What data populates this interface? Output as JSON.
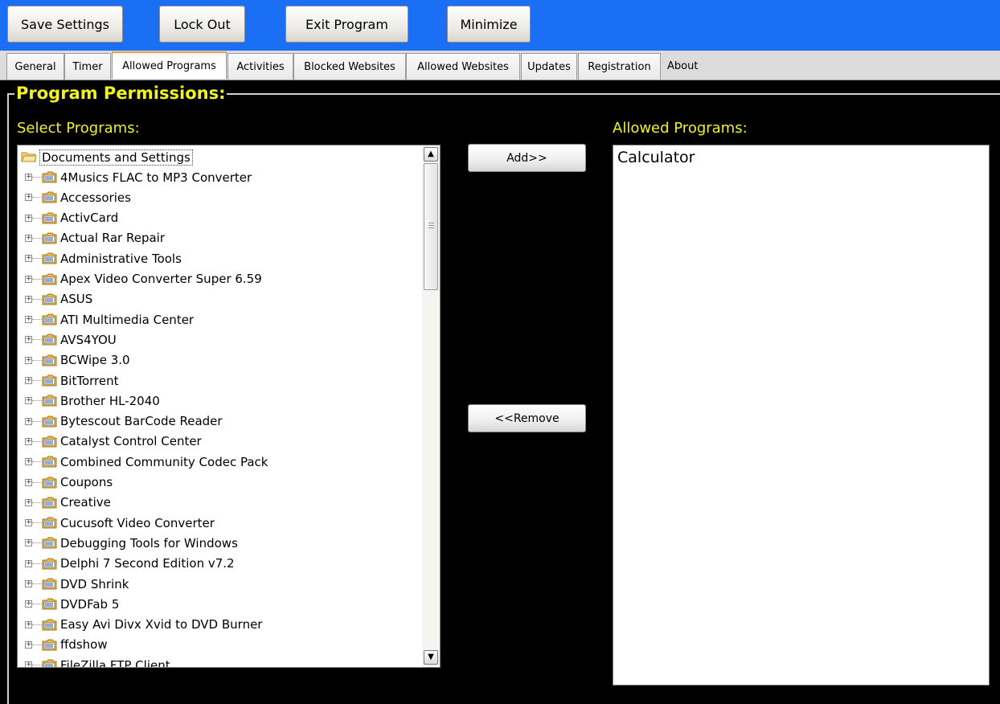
{
  "toolbar": {
    "save_settings": "Save Settings",
    "lock_out": "Lock Out",
    "exit_program": "Exit Program",
    "minimize": "Minimize"
  },
  "tabs": [
    "General",
    "Timer",
    "Allowed Programs",
    "Activities",
    "Blocked Websites",
    "Allowed Websites",
    "Updates",
    "Registration",
    "About"
  ],
  "active_tab": "Allowed Programs",
  "frame_title": "Program Permissions:",
  "select_label": "Select Programs:",
  "allowed_label": "Allowed Programs:",
  "tree": {
    "root": "Documents and Settings",
    "items": [
      "4Musics FLAC to MP3 Converter",
      "Accessories",
      "ActivCard",
      "Actual Rar Repair",
      "Administrative Tools",
      "Apex Video Converter Super 6.59",
      "ASUS",
      "ATI Multimedia Center",
      "AVS4YOU",
      "BCWipe 3.0",
      "BitTorrent",
      "Brother HL-2040",
      "Bytescout BarCode Reader",
      "Catalyst Control Center",
      "Combined Community Codec Pack",
      "Coupons",
      "Creative",
      "Cucusoft Video Converter",
      "Debugging Tools for Windows",
      "Delphi 7 Second Edition v7.2",
      "DVD Shrink",
      "DVDFab 5",
      "Easy Avi Divx Xvid to DVD Burner",
      "ffdshow",
      "FileZilla FTP Client"
    ]
  },
  "buttons": {
    "add": "Add>>",
    "remove": "<<Remove"
  },
  "allowed_programs": [
    "Calculator"
  ],
  "colors": {
    "toolbar_bg": "#1a6ff5",
    "label_yellow": "#f2f21e",
    "tab_accent": "#f0a030"
  },
  "icons": {
    "root": "open-folder-icon",
    "item": "program-group-folder-icon",
    "expand": "plus-box-icon"
  }
}
